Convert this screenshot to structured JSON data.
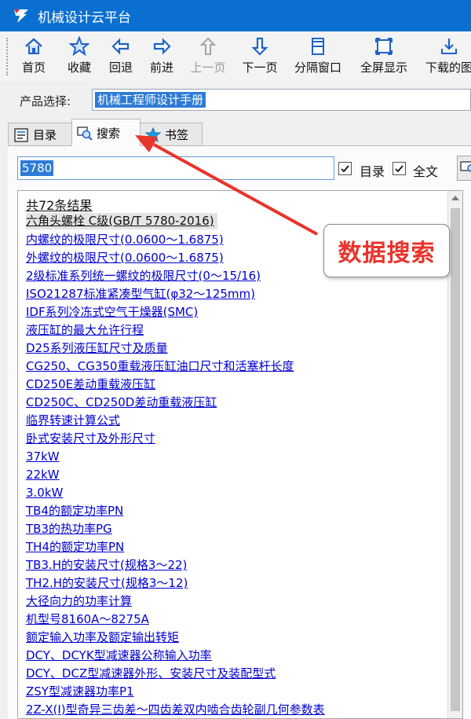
{
  "window": {
    "title": "机械设计云平台"
  },
  "toolbar": {
    "items": [
      {
        "label": "首页",
        "icon": "home-icon"
      },
      {
        "label": "收藏",
        "icon": "star-icon"
      },
      {
        "label": "回退",
        "icon": "arrow-left-icon"
      },
      {
        "label": "前进",
        "icon": "arrow-right-icon"
      },
      {
        "label": "上一页",
        "icon": "arrow-up-icon",
        "disabled": true
      },
      {
        "label": "下一页",
        "icon": "arrow-down-icon"
      },
      {
        "label": "分隔窗口",
        "icon": "split-window-icon"
      },
      {
        "label": "全屏显示",
        "icon": "fullscreen-icon"
      },
      {
        "label": "下载的图",
        "icon": "download-icon"
      }
    ]
  },
  "product": {
    "label": "产品选择:",
    "value": "机械工程师设计手册"
  },
  "tabs": [
    {
      "label": "目录",
      "icon": "catalog-icon"
    },
    {
      "label": "搜索",
      "icon": "search-icon",
      "active": true
    },
    {
      "label": "书签",
      "icon": "bookmark-star-icon"
    }
  ],
  "search": {
    "query": "5780",
    "options": [
      {
        "label": "目录",
        "checked": true
      },
      {
        "label": "全文",
        "checked": true
      }
    ]
  },
  "results": {
    "count_text": "共72条结果",
    "items": [
      "六角头螺栓 C级(GB/T 5780-2016)",
      "内螺纹的极限尺寸(0.0600～1.6875)",
      "外螺纹的极限尺寸(0.0600～1.6875)",
      "2级标准系列统一螺纹的极限尺寸(0～15/16)",
      "ISO21287标准紧凑型气缸(φ32～125mm)",
      "IDF系列冷冻式空气干燥器(SMC)",
      "液压缸的最大允许行程",
      "D25系列液压缸尺寸及质量",
      "CG250、CG350重载液压缸油口尺寸和活塞杆长度",
      "CD250E差动重载液压缸",
      "CD250C、CD250D差动重载液压缸",
      "临界转速计算公式",
      "卧式安装尺寸及外形尺寸",
      "37kW",
      "22kW",
      "3.0kW",
      "TB4的额定功率PN",
      "TB3的热功率PG",
      "TH4的额定功率PN",
      "TB3.H的安装尺寸(规格3～22)",
      "TH2.H的安装尺寸(规格3～12)",
      "大径向力的功率计算",
      "机型号8160A～8275A",
      "额定输入功率及额定输出转矩",
      "DCY、DCYK型减速器公称输入功率",
      "DCY、DCZ型减速器外形、安装尺寸及装配型式",
      "ZSY型减速器功率P1",
      "2Z-X(Ⅰ)型奇异三齿差～四齿差双内啮合齿轮副几何参数表"
    ]
  },
  "callout": {
    "text": "数据搜索"
  },
  "colors": {
    "titlebar": "#0a6fd0",
    "link": "#0000d0",
    "callout_text": "#e8342c",
    "arrow": "#e8342c",
    "selection": "#2e7bd6"
  }
}
